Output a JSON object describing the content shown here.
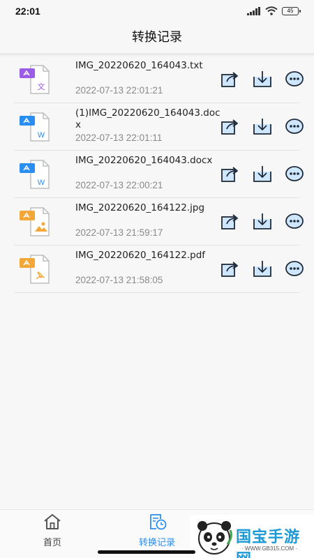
{
  "status_bar": {
    "time": "22:01",
    "battery": "45",
    "icons": [
      "signal-icon",
      "wifi-icon",
      "battery-icon"
    ]
  },
  "header": {
    "title": "转换记录"
  },
  "colors": {
    "accent": "#2a8df0",
    "txt": "#9b5de5",
    "word": "#2a8df0",
    "image": "#f3a738",
    "pdf": "#f3a738"
  },
  "records": [
    {
      "type": "txt",
      "badge": "文",
      "name": "IMG_20220620_164043.txt",
      "time": "2022-07-13 22:01:21"
    },
    {
      "type": "word",
      "badge": "W",
      "name": "(1)IMG_20220620_164043.docx",
      "time": "2022-07-13 22:01:11"
    },
    {
      "type": "word",
      "badge": "W",
      "name": "IMG_20220620_164043.docx",
      "time": "2022-07-13 22:00:21"
    },
    {
      "type": "image",
      "badge": "",
      "name": "IMG_20220620_164122.jpg",
      "time": "2022-07-13 21:59:17"
    },
    {
      "type": "pdf",
      "badge": "",
      "name": "IMG_20220620_164122.pdf",
      "time": "2022-07-13 21:58:05"
    }
  ],
  "tabbar": {
    "home_label": "首页",
    "history_label": "转换记录"
  },
  "watermark": {
    "title": "国宝手游网",
    "subtitle": "· WWW.GB315.COM ·"
  }
}
